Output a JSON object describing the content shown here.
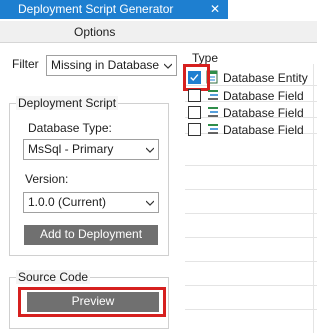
{
  "window": {
    "tab_title": "Deployment Script Generator",
    "close_glyph": "✕"
  },
  "menu": {
    "options_label": "Options"
  },
  "filter": {
    "label": "Filter",
    "selected": "Missing in Database"
  },
  "deployment_script": {
    "group_title": "Deployment Script",
    "database_type_label": "Database Type:",
    "database_type_selected": "MsSql - Primary",
    "version_label": "Version:",
    "version_selected": "1.0.0 (Current)",
    "add_button_label": "Add to Deployment"
  },
  "source_code": {
    "group_title": "Source Code",
    "preview_button_label": "Preview"
  },
  "type_list": {
    "header": "Type",
    "rows": [
      {
        "label": "Database Entity",
        "checked": true,
        "icon": "database-entity-icon"
      },
      {
        "label": "Database Field",
        "checked": false,
        "icon": "database-field-icon"
      },
      {
        "label": "Database Field",
        "checked": false,
        "icon": "database-field-icon"
      },
      {
        "label": "Database Field",
        "checked": false,
        "icon": "database-field-icon"
      }
    ]
  },
  "colors": {
    "tab_blue": "#1e7fd0",
    "button_gray": "#707070",
    "highlight_red": "#d6201f"
  }
}
